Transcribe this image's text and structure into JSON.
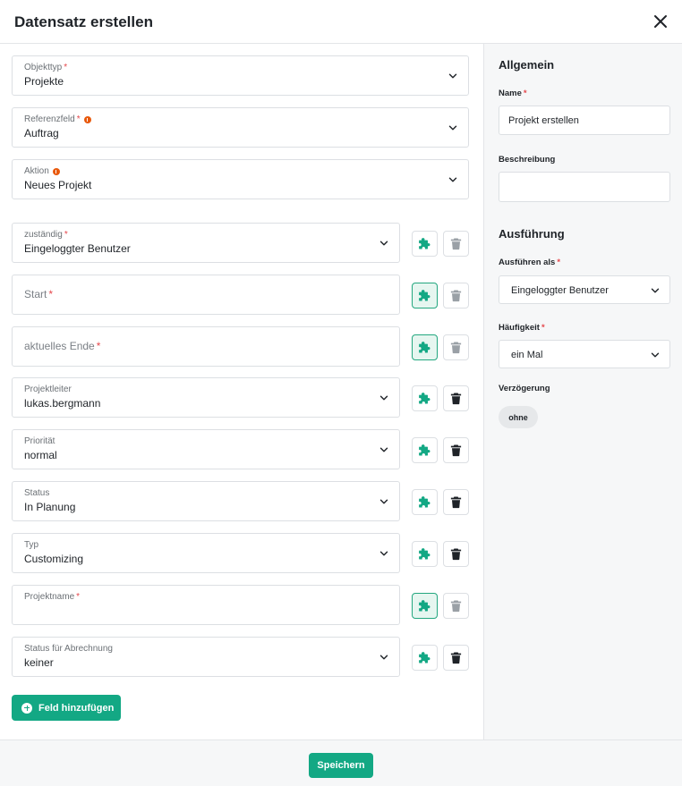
{
  "dialog": {
    "title": "Datensatz erstellen"
  },
  "icons": {
    "close": "close-icon",
    "chevron": "chevron-down-icon",
    "puzzle": "puzzle-icon",
    "trash": "trash-icon",
    "info": "info-icon",
    "plus": "plus-circle-icon"
  },
  "colors": {
    "accent": "#13a884",
    "required": "#e5484d",
    "info": "#e8590c"
  },
  "top_fields": [
    {
      "label": "Objekttyp",
      "required": "*",
      "value": "Projekte"
    },
    {
      "label": "Referenzfeld",
      "required": "*",
      "value": "Auftrag"
    },
    {
      "label": "Aktion",
      "required": "",
      "value": "Neues Projekt"
    }
  ],
  "fields": [
    {
      "label": "zuständig",
      "required": "*",
      "value": "Eingeloggter Benutzer"
    },
    {
      "label": "Start",
      "required": "*",
      "value": ""
    },
    {
      "label": "aktuelles Ende",
      "required": "*",
      "value": ""
    },
    {
      "label": "Projektleiter",
      "required": "",
      "value": "lukas.bergmann"
    },
    {
      "label": "Priorität",
      "required": "",
      "value": "normal"
    },
    {
      "label": "Status",
      "required": "",
      "value": "In Planung"
    },
    {
      "label": "Typ",
      "required": "",
      "value": "Customizing"
    },
    {
      "label": "Projektname",
      "required": "*",
      "value": ""
    },
    {
      "label": "Status für Abrechnung",
      "required": "",
      "value": "keiner"
    }
  ],
  "add_field_label": "Feld hinzufügen",
  "general": {
    "title": "Allgemein",
    "name_label": "Name",
    "name_required": "*",
    "name_value": "Projekt erstellen",
    "description_label": "Beschreibung",
    "description_value": ""
  },
  "execution": {
    "title": "Ausführung",
    "run_as_label": "Ausführen als",
    "run_as_required": "*",
    "run_as_value": "Eingeloggter Benutzer",
    "frequency_label": "Häufigkeit",
    "frequency_required": "*",
    "frequency_value": "ein Mal",
    "delay_label": "Verzögerung",
    "delay_value": "ohne"
  },
  "footer": {
    "save_label": "Speichern"
  }
}
